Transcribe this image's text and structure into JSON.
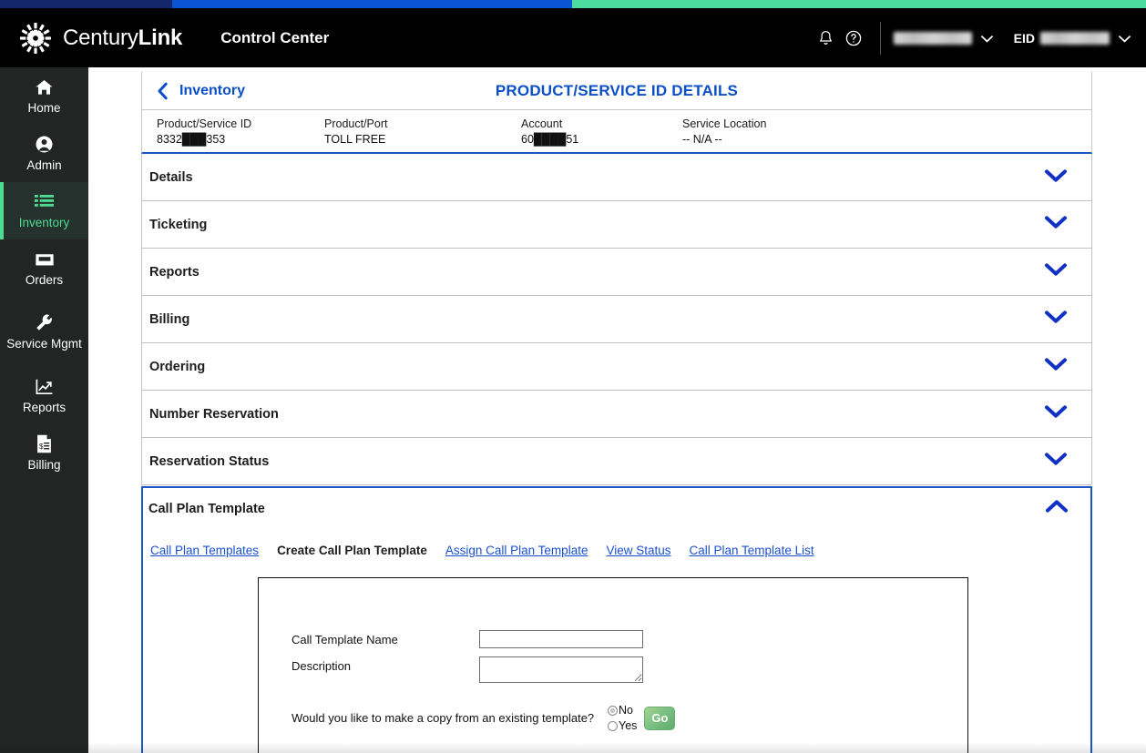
{
  "brand": {
    "logo_icon": "centurylink-burst-logo",
    "name_light": "Century",
    "name_bold": "Link",
    "app_title": "Control Center",
    "accent_blue": "#0b4fc7",
    "accent_green": "#4ddb92",
    "strip_colors": [
      "#14276b",
      "#0b54d6",
      "#4ddba0"
    ]
  },
  "topbar": {
    "notifications_icon": "bell-icon",
    "help_icon": "help-circle-icon",
    "user_name": "",
    "user_chevron_icon": "chevron-down-icon",
    "eid_label": "EID",
    "eid_value": "",
    "eid_chevron_icon": "chevron-down-icon"
  },
  "sidebar": {
    "items": [
      {
        "label": "Home",
        "icon": "home-icon",
        "active": false
      },
      {
        "label": "Admin",
        "icon": "user-circle-icon",
        "active": false
      },
      {
        "label": "Inventory",
        "icon": "list-icon",
        "active": true
      },
      {
        "label": "Orders",
        "icon": "inbox-tray-icon",
        "active": false
      },
      {
        "label": "Service Mgmt",
        "icon": "wrench-icon",
        "active": false
      },
      {
        "label": "Reports",
        "icon": "chart-line-icon",
        "active": false
      },
      {
        "label": "Billing",
        "icon": "invoice-icon",
        "active": false
      }
    ]
  },
  "breadcrumb": {
    "back_icon": "chevron-left-icon",
    "back_label": "Inventory"
  },
  "page": {
    "title": "PRODUCT/SERVICE ID DETAILS"
  },
  "summary": {
    "columns": [
      {
        "label": "Product/Service ID",
        "value": "8332███353"
      },
      {
        "label": "Product/Port",
        "value": "TOLL FREE"
      },
      {
        "label": "Account",
        "value": "60████51"
      },
      {
        "label": "Service Location",
        "value": "-- N/A --"
      }
    ]
  },
  "accordion": {
    "collapsed_icon": "chevron-down-icon",
    "expanded_icon": "chevron-up-icon",
    "sections": [
      {
        "title": "Details",
        "expanded": false
      },
      {
        "title": "Ticketing",
        "expanded": false
      },
      {
        "title": "Reports",
        "expanded": false
      },
      {
        "title": "Billing",
        "expanded": false
      },
      {
        "title": "Ordering",
        "expanded": false
      },
      {
        "title": "Number Reservation",
        "expanded": false
      },
      {
        "title": "Reservation Status",
        "expanded": false
      }
    ],
    "open_section": {
      "title": "Call Plan Template",
      "expanded": true
    }
  },
  "subnav": {
    "links": [
      {
        "label": "Call Plan Templates",
        "current": false
      },
      {
        "label": "Create Call Plan Template",
        "current": true
      },
      {
        "label": "Assign Call Plan Template",
        "current": false
      },
      {
        "label": "View Status",
        "current": false
      },
      {
        "label": "Call Plan Template List",
        "current": false
      }
    ]
  },
  "form": {
    "name_label": "Call Template Name",
    "name_value": "",
    "description_label": "Description",
    "description_value": "",
    "copy_question": "Would you like to make a copy from an existing template?",
    "radio_no": "No",
    "radio_yes": "Yes",
    "radio_selected": "No",
    "go_label": "Go",
    "go_color": "#6fb87a"
  }
}
